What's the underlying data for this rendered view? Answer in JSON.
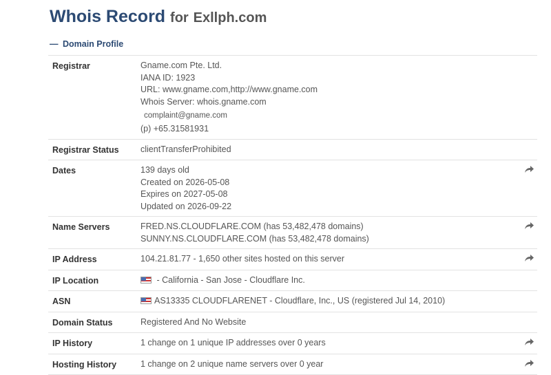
{
  "header": {
    "title": "Whois Record",
    "domain_prefix": "for",
    "domain": "Exllph.com"
  },
  "section": {
    "toggle_glyph": "—",
    "label": "Domain Profile"
  },
  "rows": {
    "registrar": {
      "label": "Registrar",
      "name": "Gname.com Pte. Ltd.",
      "iana": "IANA ID: 1923",
      "url": "URL: www.gname.com,http://www.gname.com",
      "whois_server": "Whois Server: whois.gname.com",
      "email": "complaint@gname.com",
      "phone": "(p)  +65.31581931"
    },
    "registrar_status": {
      "label": "Registrar Status",
      "value": "clientTransferProhibited"
    },
    "dates": {
      "label": "Dates",
      "age": "139 days old",
      "created": "Created on 2026-05-08",
      "expires": "Expires on 2027-05-08",
      "updated": "Updated on 2026-09-22"
    },
    "name_servers": {
      "label": "Name Servers",
      "ns1": "FRED.NS.CLOUDFLARE.COM (has 53,482,478 domains)",
      "ns2": "SUNNY.NS.CLOUDFLARE.COM (has 53,482,478 domains)"
    },
    "ip_address": {
      "label": "IP Address",
      "value": "104.21.81.77 - 1,650 other sites hosted on this server"
    },
    "ip_location": {
      "label": "IP Location",
      "value": " - California - San Jose - Cloudflare Inc."
    },
    "asn": {
      "label": "ASN",
      "value": "AS13335 CLOUDFLARENET - Cloudflare, Inc., US (registered Jul 14, 2010)"
    },
    "domain_status": {
      "label": "Domain Status",
      "value": "Registered And No Website"
    },
    "ip_history": {
      "label": "IP History",
      "value": "1 change on 1 unique IP addresses over 0 years"
    },
    "hosting_history": {
      "label": "Hosting History",
      "value": "1 change on 2 unique name servers over 0 year"
    }
  },
  "icons": {
    "share": "share-arrow-icon",
    "flag": "us-flag-icon"
  },
  "colors": {
    "title": "#2c4a73",
    "border": "#e2e2e2",
    "label": "#333333",
    "value": "#555555",
    "icon": "#666666"
  }
}
